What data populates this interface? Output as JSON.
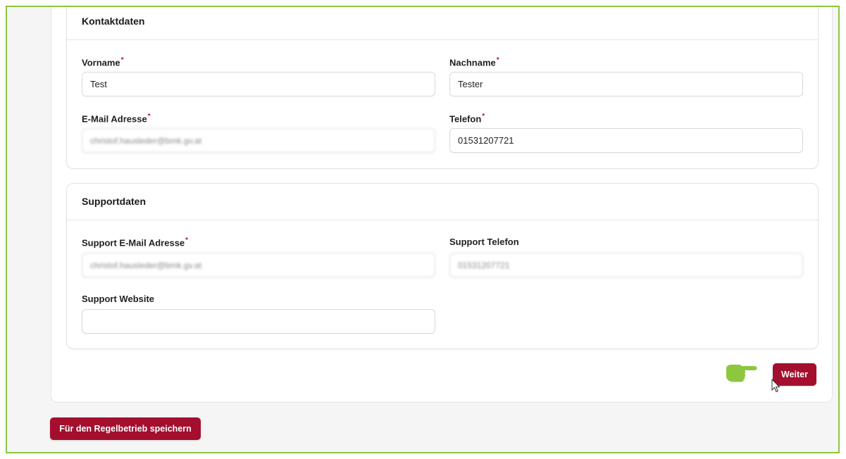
{
  "contact_section": {
    "title": "Kontaktdaten",
    "fields": {
      "first_name": {
        "label": "Vorname",
        "required_mark": "*",
        "value": "Test"
      },
      "last_name": {
        "label": "Nachname",
        "required_mark": "*",
        "value": "Tester"
      },
      "email": {
        "label": "E-Mail Adresse",
        "required_mark": "*",
        "value": "christof.hausleder@bmk.gv.at"
      },
      "phone": {
        "label": "Telefon",
        "required_mark": "*",
        "value": "01531207721"
      }
    }
  },
  "support_section": {
    "title": "Supportdaten",
    "fields": {
      "support_email": {
        "label": "Support E-Mail Adresse",
        "required_mark": "*",
        "value": "christof.hausleder@bmk.gv.at"
      },
      "support_phone": {
        "label": "Support Telefon",
        "value": "01531207721"
      },
      "support_website": {
        "label": "Support Website",
        "value": ""
      }
    }
  },
  "actions": {
    "next_label": "Weiter",
    "save_label": "Für den Regelbetrieb speichern"
  },
  "icons": {
    "pointing_hand": "pointing-hand-icon",
    "mouse_cursor": "mouse-cursor-icon"
  },
  "colors": {
    "accent": "#a30f2d",
    "highlight_border": "#8dc63f",
    "required_star": "#b01733"
  }
}
